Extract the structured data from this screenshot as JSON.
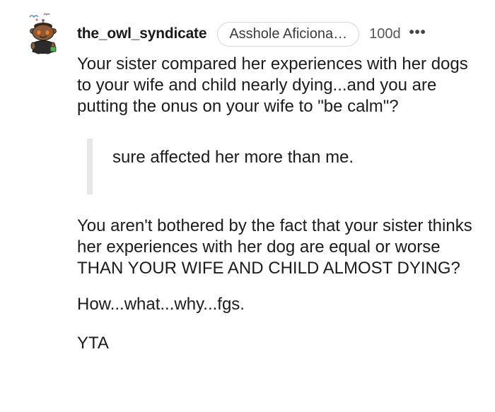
{
  "comment": {
    "author": "the_owl_syndicate",
    "flair": "Asshole Aficiona…",
    "age": "100d",
    "more_label": "•••",
    "avatar_icon": "snoo-avatar-icon",
    "paragraphs": [
      "Your sister compared her experiences with her dogs to your wife and child nearly dying...and you are putting the onus on your wife to \"be calm\"?",
      "You aren't bothered by the fact that your sister thinks her experiences with her dog are equal or worse THAN YOUR WIFE AND CHILD ALMOST DYING?",
      "How...what...why...fgs.",
      "YTA"
    ],
    "quote": "sure affected her more than me."
  },
  "colors": {
    "text": "#1c1c1c",
    "quote_bar": "#e7e7e7",
    "flair_border": "#d8d8d8"
  }
}
